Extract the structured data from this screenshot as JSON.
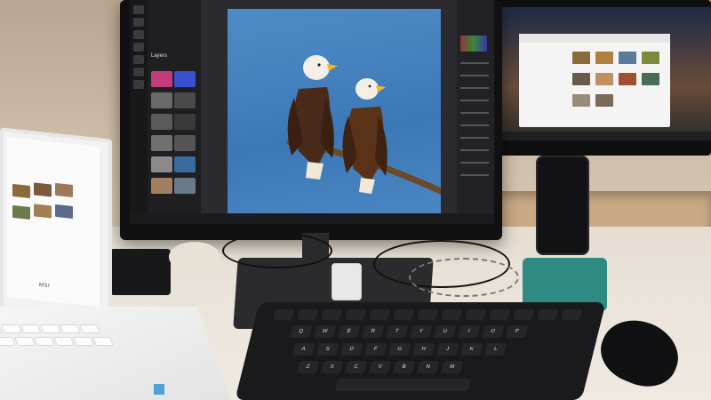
{
  "scene": {
    "description_hidden": "",
    "laptop_brand_text": "MSI"
  },
  "monitor_ui": {
    "layers_label": "Layers",
    "canvas_subject": "two bald eagles on a branch"
  },
  "keyboard": {
    "row_labels": [
      "Q",
      "W",
      "E",
      "R",
      "T",
      "Y",
      "U",
      "I",
      "O",
      "P"
    ],
    "home_labels": [
      "A",
      "S",
      "D",
      "F",
      "G",
      "H",
      "J",
      "K",
      "L"
    ],
    "bottom_labels": [
      "Z",
      "X",
      "C",
      "V",
      "B",
      "N",
      "M"
    ]
  },
  "icons": [
    "eagle-photo",
    "keyboard",
    "mouse",
    "phone",
    "usb-adapter"
  ],
  "colors": {
    "canvas_sky": "#3c78b7",
    "desk": "#ece6dd",
    "phone_stand": "#2f8a83",
    "keyboard": "#1a1a1c"
  }
}
